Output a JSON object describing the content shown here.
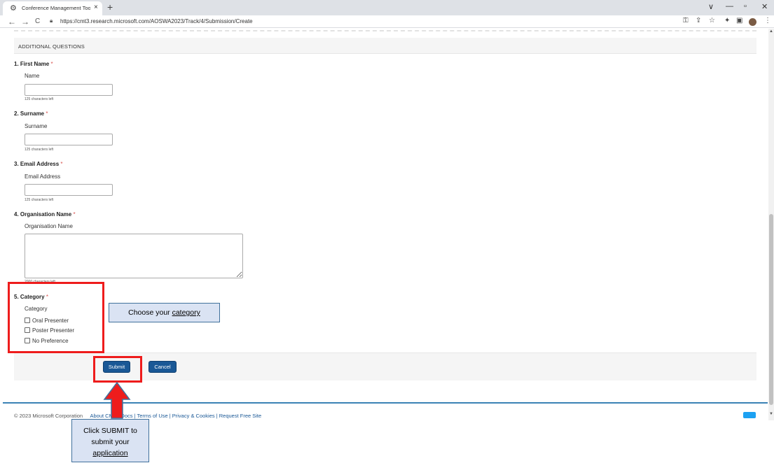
{
  "browser": {
    "tab_title": "Conference Management Toolkit",
    "tab_close": "×",
    "new_tab": "+",
    "url": "https://cmt3.research.microsoft.com/AOSWA2023/Track/4/Submission/Create",
    "window_controls": [
      "∨",
      "—",
      "▫",
      "✕"
    ],
    "nav": {
      "back": "←",
      "forward": "→",
      "reload": "C"
    },
    "icons": [
      "key-icon",
      "share-icon",
      "star-icon",
      "extensions-icon",
      "side-panel-icon",
      "profile-avatar",
      "menu-icon"
    ]
  },
  "section": {
    "title": "ADDITIONAL QUESTIONS"
  },
  "questions": [
    {
      "title": "1. First Name",
      "required": "*",
      "label": "Name",
      "hint": "125 characters left"
    },
    {
      "title": "2. Surname",
      "required": "*",
      "label": "Surname",
      "hint": "125 characters left"
    },
    {
      "title": "3. Email Address",
      "required": "*",
      "label": "Email Address",
      "hint": "125 characters left"
    },
    {
      "title": "4. Organisation Name",
      "required": "*",
      "label": "Organisation Name",
      "hint": "2000 characters left"
    },
    {
      "title": "5. Category",
      "required": "*",
      "label": "Category",
      "options": [
        "Oral Presenter",
        "Poster Presenter",
        "No Preference"
      ]
    }
  ],
  "buttons": {
    "submit": "Submit",
    "cancel": "Cancel"
  },
  "footer": {
    "copyright": "© 2023 Microsoft Corporation",
    "links_text": "About CMT | Docs | Terms of Use | Privacy & Cookies | Request Free Site"
  },
  "annotations": {
    "category_callout_prefix": "Choose your ",
    "category_callout_link": "category",
    "submit_callout_line1": "Click SUBMIT to",
    "submit_callout_line2": "submit your",
    "submit_callout_link": "application"
  },
  "colors": {
    "highlight": "#ee1c1c",
    "callout_fill": "#dae3f3",
    "button": "#1a5896",
    "footer_accent": "#3b82b5"
  }
}
